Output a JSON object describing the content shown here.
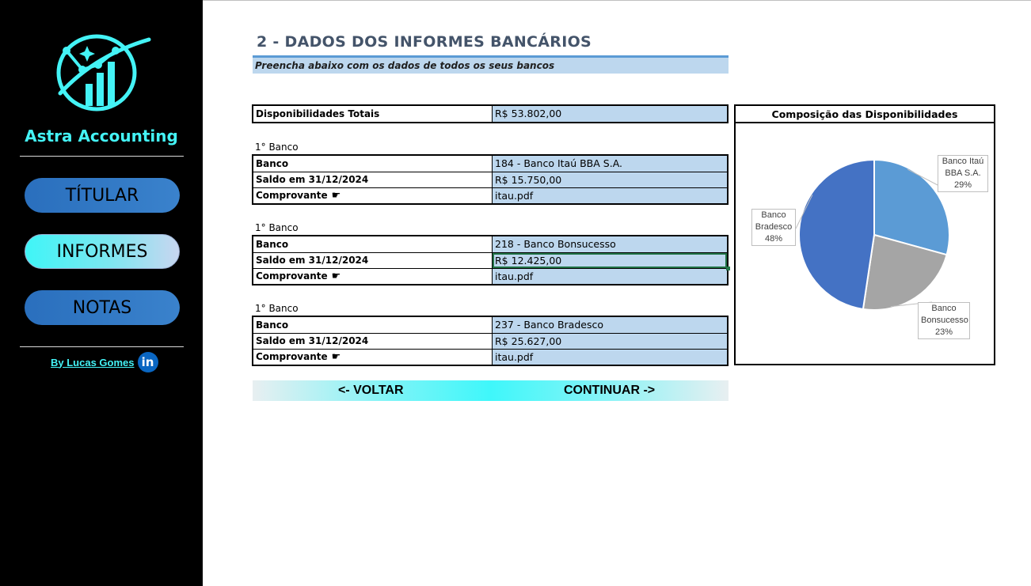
{
  "sidebar": {
    "brand": "Astra Accounting",
    "nav": [
      {
        "label": "TÍTULAR"
      },
      {
        "label": "INFORMES"
      },
      {
        "label": "NOTAS"
      }
    ],
    "byline": "By Lucas Gomes",
    "linkedin_glyph": "in"
  },
  "main": {
    "title": "2 - DADOS DOS INFORMES BANCÁRIOS",
    "subtitle": "Preencha abaixo com os dados de todos os seus bancos",
    "total": {
      "label": "Disponibilidades Totais",
      "value": "R$ 53.802,00"
    },
    "banks": [
      {
        "caption": "1° Banco",
        "banco_label": "Banco",
        "banco_value": "184 - Banco Itaú BBA S.A.",
        "saldo_label": "Saldo em 31/12/2024",
        "saldo_value": "R$ 15.750,00",
        "comprovante_label": "Comprovante",
        "comprovante_value": "itau.pdf"
      },
      {
        "caption": "1° Banco",
        "banco_label": "Banco",
        "banco_value": "218 - Banco Bonsucesso",
        "saldo_label": "Saldo em 31/12/2024",
        "saldo_value": "R$ 12.425,00",
        "comprovante_label": "Comprovante",
        "comprovante_value": "itau.pdf"
      },
      {
        "caption": "1° Banco",
        "banco_label": "Banco",
        "banco_value": "237 - Banco Bradesco",
        "saldo_label": "Saldo em 31/12/2024",
        "saldo_value": "R$ 25.627,00",
        "comprovante_label": "Comprovante",
        "comprovante_value": "itau.pdf"
      }
    ],
    "back_label": "<- VOLTAR",
    "continue_label": "CONTINUAR ->",
    "hand_icon": "hand-pointer-icon"
  },
  "colors": {
    "accent_cyan": "#44f3f6",
    "nav_blue": "#2a6fbd",
    "cell_blue": "#bdd7ee",
    "title_gray": "#44546a"
  },
  "chart_data": {
    "type": "pie",
    "title": "Composição das Disponibilidades",
    "slices": [
      {
        "label_lines": [
          "Banco Itaú",
          "BBA S.A."
        ],
        "percent_label": "29%",
        "value": 15750,
        "color": "#5b9bd5"
      },
      {
        "label_lines": [
          "Banco",
          "Bonsucesso"
        ],
        "percent_label": "23%",
        "value": 12425,
        "color": "#a5a5a5"
      },
      {
        "label_lines": [
          "Banco",
          "Bradesco"
        ],
        "percent_label": "48%",
        "value": 25627,
        "color": "#4472c4"
      }
    ]
  }
}
